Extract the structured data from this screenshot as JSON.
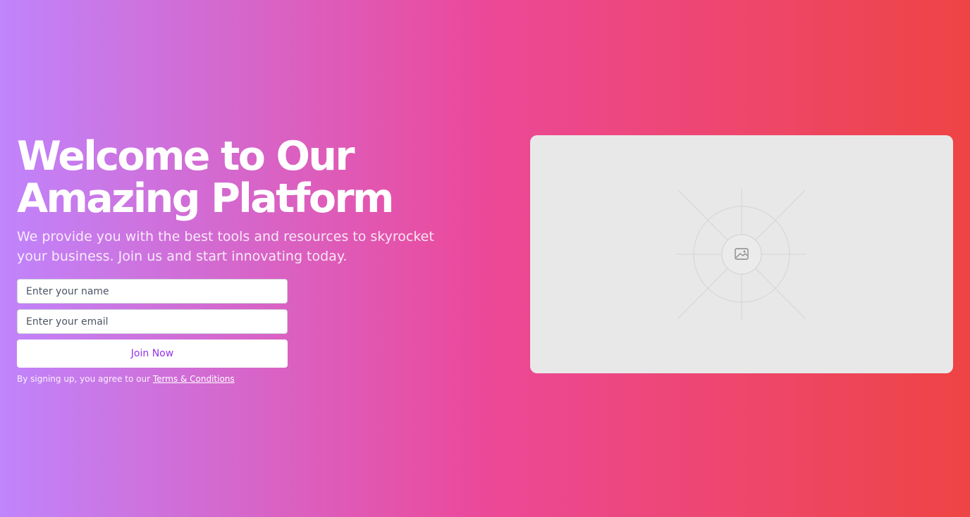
{
  "hero": {
    "title": "Welcome to Our Amazing Platform",
    "subtitle": "We provide you with the best tools and resources to skyrocket your business. Join us and start innovating today."
  },
  "form": {
    "name_placeholder": "Enter your name",
    "email_placeholder": "Enter your email",
    "submit_label": "Join Now",
    "legal_text": "By signing up, you agree to our ",
    "legal_link": "Terms & Conditions"
  },
  "media": {
    "icon": "image-placeholder-icon"
  },
  "colors": {
    "gradient_start": "#c084fc",
    "gradient_mid": "#ec4899",
    "gradient_end": "#ef4444",
    "button_text": "#9333ea",
    "placeholder_bg": "#e8e8e8"
  }
}
